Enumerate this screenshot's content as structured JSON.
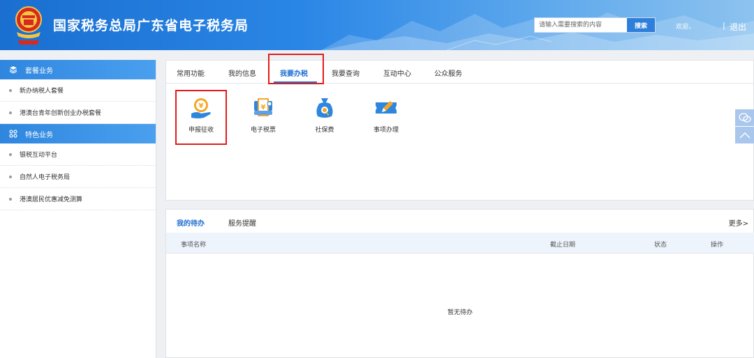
{
  "header": {
    "title": "国家税务总局广东省电子税务局",
    "search_placeholder": "请输入需要搜索的内容",
    "search_button": "搜索",
    "welcome": "欢迎，",
    "separator": "|",
    "logout": "退出",
    "colors": {
      "bg_start": "#1a6fd0",
      "bg_end": "#8dc3ef"
    }
  },
  "sidebar": {
    "sections": [
      {
        "icon": "layers-icon",
        "label": "套餐业务",
        "items": [
          "新办纳税人套餐",
          "港澳台青年创新创业办税套餐"
        ]
      },
      {
        "icon": "grid-icon",
        "label": "特色业务",
        "items": [
          "银税互动平台",
          "自然人电子税务局",
          "港澳居民优惠减免测算"
        ]
      }
    ]
  },
  "tabs": [
    "常用功能",
    "我的信息",
    "我要办税",
    "我要查询",
    "互动中心",
    "公众服务"
  ],
  "active_tab": "我要办税",
  "functions": [
    {
      "label": "申报征收",
      "icon": "tax-declaration-icon",
      "highlighted": true
    },
    {
      "label": "电子税票",
      "icon": "e-tax-receipt-icon"
    },
    {
      "label": "社保费",
      "icon": "social-security-icon"
    },
    {
      "label": "事项办理",
      "icon": "edit-ticket-icon"
    }
  ],
  "todo": {
    "tabs": [
      "我的待办",
      "服务提醒"
    ],
    "more": "更多>",
    "columns": [
      "事项名称",
      "截止日期",
      "状态",
      "操作"
    ],
    "empty_text": "暂无待办"
  },
  "accent_color": "#1f6fd1",
  "highlight_color": "#e21b1b"
}
